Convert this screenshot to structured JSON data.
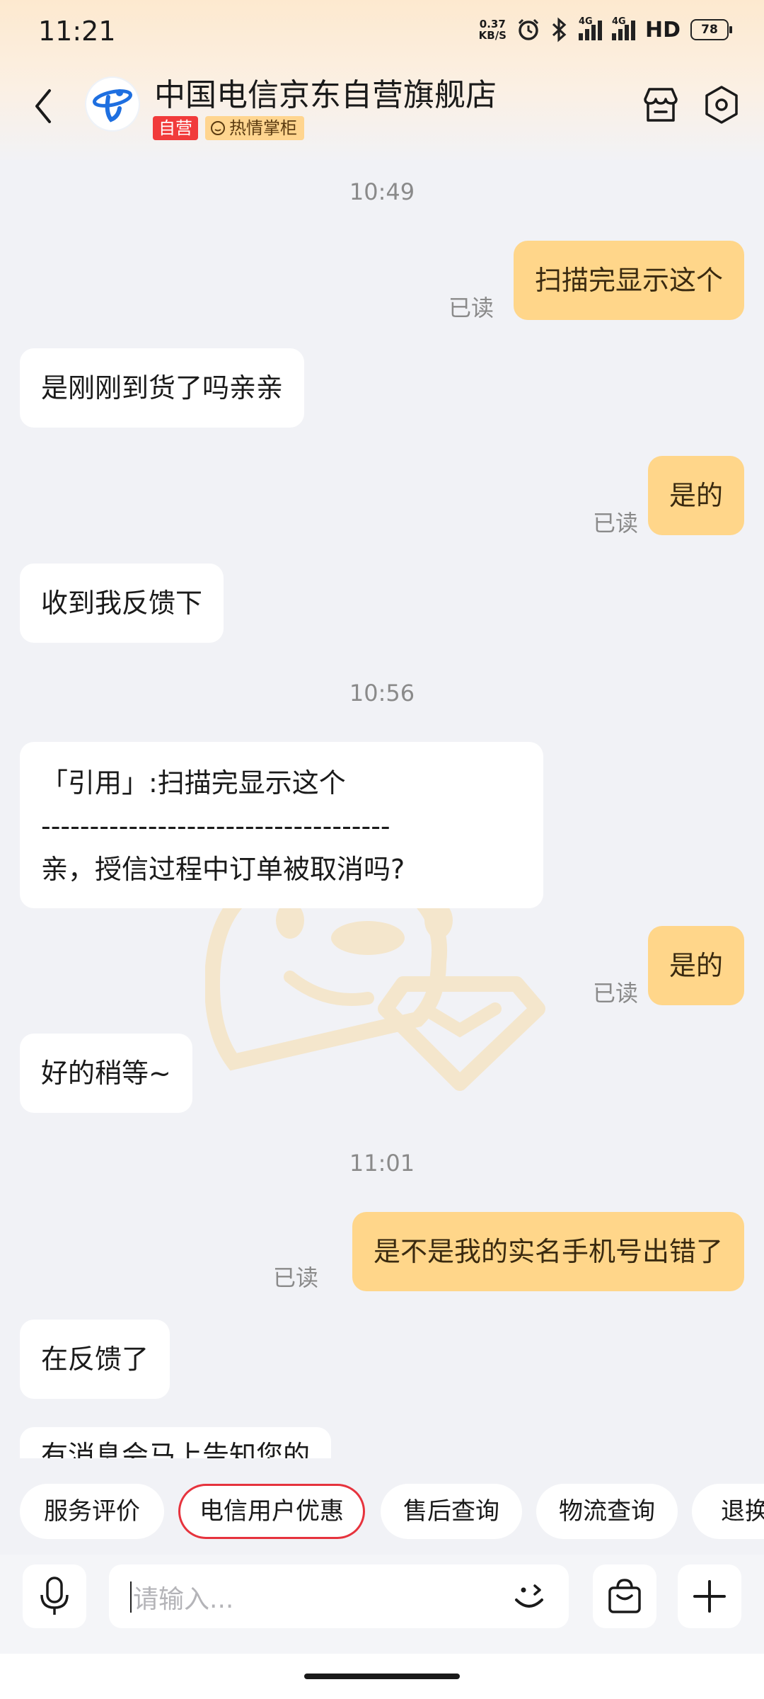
{
  "status_bar": {
    "time": "11:21",
    "net_speed_value": "0.37",
    "net_speed_unit": "KB/S",
    "net_label_1": "4G",
    "net_label_2": "4G",
    "hd": "HD",
    "battery": "78"
  },
  "header": {
    "store_name": "中国电信京东自营旗舰店",
    "tag_self": "自营",
    "tag_host": "热情掌柜"
  },
  "chat": {
    "messages": [
      {
        "kind": "time",
        "text": "10:49"
      },
      {
        "kind": "out",
        "text": "扫描完显示这个",
        "read": "已读"
      },
      {
        "kind": "in",
        "text": "是刚刚到货了吗亲亲"
      },
      {
        "kind": "out",
        "text": "是的",
        "read": "已读"
      },
      {
        "kind": "in",
        "text": "收到我反馈下"
      },
      {
        "kind": "time",
        "text": "10:56"
      },
      {
        "kind": "in_quote",
        "quote": "「引用」:扫描完显示这个",
        "divider": "------------------------------------",
        "text": "亲，授信过程中订单被取消吗?"
      },
      {
        "kind": "out",
        "text": "是的",
        "read": "已读"
      },
      {
        "kind": "in",
        "text": "好的稍等~"
      },
      {
        "kind": "time",
        "text": "11:01"
      },
      {
        "kind": "out",
        "text": "是不是我的实名手机号出错了",
        "read": "已读"
      },
      {
        "kind": "in",
        "text": "在反馈了"
      },
      {
        "kind": "in_partial",
        "text": "有消息会马上告知您的"
      }
    ]
  },
  "quick_replies": [
    "服务评价",
    "电信用户优惠",
    "售后查询",
    "物流查询",
    "退换"
  ],
  "quick_reply_selected": "电信用户优惠",
  "input": {
    "placeholder": "请输入..."
  },
  "colors": {
    "outgoing_bubble": "#ffd68a",
    "incoming_bubble": "#ffffff",
    "background": "#f1f2f6",
    "tag_red": "#f13b3b",
    "chip_highlight": "#e6333d"
  }
}
